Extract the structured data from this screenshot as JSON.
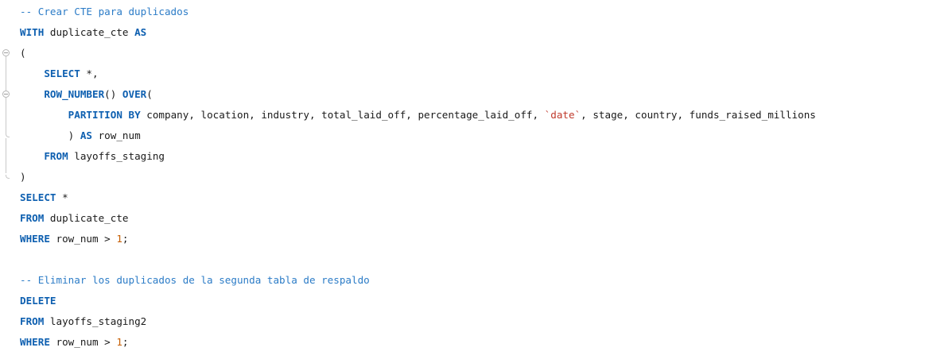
{
  "editor": {
    "lines": [
      [
        {
          "t": "-- Crear CTE para duplicados",
          "c": "cm"
        }
      ],
      [
        {
          "t": "WITH",
          "c": "kw"
        },
        {
          "t": " duplicate_cte ",
          "c": "id"
        },
        {
          "t": "AS",
          "c": "kw"
        }
      ],
      [
        {
          "t": "(",
          "c": "id"
        }
      ],
      [
        {
          "t": "    ",
          "c": "id"
        },
        {
          "t": "SELECT",
          "c": "kw"
        },
        {
          "t": " *,",
          "c": "id"
        }
      ],
      [
        {
          "t": "    ",
          "c": "id"
        },
        {
          "t": "ROW_NUMBER",
          "c": "kw"
        },
        {
          "t": "() ",
          "c": "id"
        },
        {
          "t": "OVER",
          "c": "kw"
        },
        {
          "t": "(",
          "c": "id"
        }
      ],
      [
        {
          "t": "        ",
          "c": "id"
        },
        {
          "t": "PARTITION BY",
          "c": "kw"
        },
        {
          "t": " company, location, industry, total_laid_off, percentage_laid_off, ",
          "c": "id"
        },
        {
          "t": "`date`",
          "c": "str"
        },
        {
          "t": ", stage, country, funds_raised_millions",
          "c": "id"
        }
      ],
      [
        {
          "t": "        ) ",
          "c": "id"
        },
        {
          "t": "AS",
          "c": "kw"
        },
        {
          "t": " row_num",
          "c": "id"
        }
      ],
      [
        {
          "t": "    ",
          "c": "id"
        },
        {
          "t": "FROM",
          "c": "kw"
        },
        {
          "t": " layoffs_staging",
          "c": "id"
        }
      ],
      [
        {
          "t": ")",
          "c": "id"
        }
      ],
      [
        {
          "t": "SELECT",
          "c": "kw"
        },
        {
          "t": " *",
          "c": "id"
        }
      ],
      [
        {
          "t": "FROM",
          "c": "kw"
        },
        {
          "t": " duplicate_cte",
          "c": "id"
        }
      ],
      [
        {
          "t": "WHERE",
          "c": "kw"
        },
        {
          "t": " row_num > ",
          "c": "id"
        },
        {
          "t": "1",
          "c": "num"
        },
        {
          "t": ";",
          "c": "id"
        }
      ],
      [],
      [
        {
          "t": "-- Eliminar los duplicados de la segunda tabla de respaldo",
          "c": "cm"
        }
      ],
      [
        {
          "t": "DELETE",
          "c": "kw"
        }
      ],
      [
        {
          "t": "FROM",
          "c": "kw"
        },
        {
          "t": " layoffs_staging2",
          "c": "id"
        }
      ],
      [
        {
          "t": "WHERE",
          "c": "kw"
        },
        {
          "t": " row_num > ",
          "c": "id"
        },
        {
          "t": "1",
          "c": "num"
        },
        {
          "t": ";",
          "c": "id"
        }
      ]
    ]
  }
}
